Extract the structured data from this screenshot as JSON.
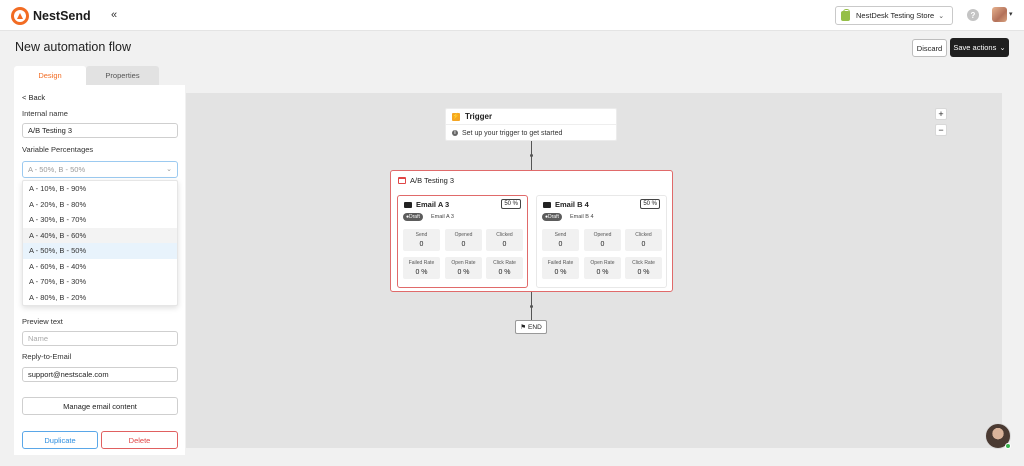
{
  "brand": {
    "name": "NestSend"
  },
  "header": {
    "collapse_glyph": "«",
    "store": "NestDesk Testing Store",
    "help": "?"
  },
  "page": {
    "title": "New automation flow",
    "discard": "Discard",
    "save_actions": "Save actions"
  },
  "tabs": [
    {
      "label": "Design",
      "active": true
    },
    {
      "label": "Properties",
      "active": false
    }
  ],
  "sidebar": {
    "back": "< Back",
    "internal_name_label": "Internal name",
    "internal_name_value": "A/B Testing 3",
    "variable_label": "Variable Percentages",
    "variable_value": "A - 50%, B - 50%",
    "options": [
      "A - 10%, B - 90%",
      "A - 20%, B - 80%",
      "A - 30%, B - 70%",
      "A - 40%, B - 60%",
      "A - 50%, B - 50%",
      "A - 60%, B - 40%",
      "A - 70%, B - 30%",
      "A - 80%, B - 20%"
    ],
    "preview_label": "Preview text",
    "preview_placeholder": "Name",
    "reply_label": "Reply-to-Email",
    "reply_value": "support@nestscale.com",
    "manage_button": "Manage email content",
    "duplicate_button": "Duplicate",
    "delete_button": "Delete"
  },
  "canvas": {
    "zoom_in": "+",
    "zoom_out": "−",
    "trigger": {
      "title": "Trigger",
      "subtitle": "Set up your trigger to get started"
    },
    "ab_test": {
      "title": "A/B Testing 3",
      "emails": [
        {
          "title": "Email A 3",
          "percent": "50 %",
          "status": "Draft",
          "name": "Email A 3",
          "stats": [
            {
              "label": "Send",
              "value": "0"
            },
            {
              "label": "Opened",
              "value": "0"
            },
            {
              "label": "Clicked",
              "value": "0"
            },
            {
              "label": "Failed Rate",
              "value": "0 %"
            },
            {
              "label": "Open Rate",
              "value": "0 %"
            },
            {
              "label": "Click Rate",
              "value": "0 %"
            }
          ]
        },
        {
          "title": "Email B 4",
          "percent": "50 %",
          "status": "Draft",
          "name": "Email B 4",
          "stats": [
            {
              "label": "Send",
              "value": "0"
            },
            {
              "label": "Opened",
              "value": "0"
            },
            {
              "label": "Clicked",
              "value": "0"
            },
            {
              "label": "Failed Rate",
              "value": "0 %"
            },
            {
              "label": "Open Rate",
              "value": "0 %"
            },
            {
              "label": "Click Rate",
              "value": "0 %"
            }
          ]
        }
      ]
    },
    "end": "END"
  },
  "colors": {
    "accent": "#f26c23",
    "ab_border": "#e06a6a",
    "duplicate": "#2e8fe0",
    "delete": "#e04646"
  }
}
